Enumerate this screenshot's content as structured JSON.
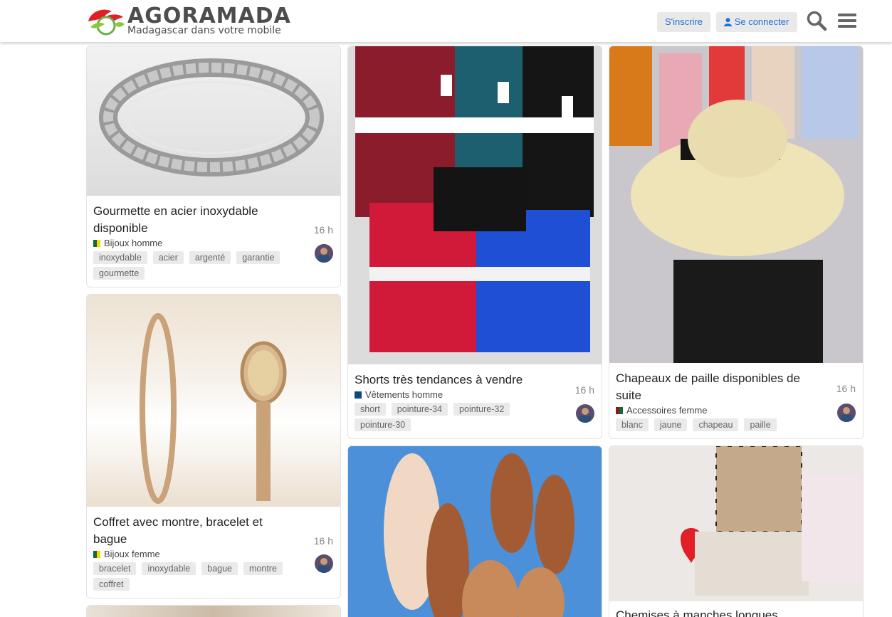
{
  "header": {
    "logo_title": "AGORAMADA",
    "logo_subtitle": "Madagascar dans votre mobile",
    "signup_label": "S'inscrire",
    "login_label": "Se connecter",
    "accent": "#1f6fd8"
  },
  "topics": [
    {
      "title": "Gourmette en acier inoxydable disponible",
      "category": "Bijoux homme",
      "category_colors": [
        "#0d6b3a",
        "#ffd400"
      ],
      "tags": [
        "inoxydable",
        "acier",
        "argenté",
        "garantie",
        "gourmette"
      ],
      "age": "16 h"
    },
    {
      "title": "Coffret avec montre, bracelet et bague",
      "category": "Bijoux femme",
      "category_colors": [
        "#0d6b3a",
        "#ffd400"
      ],
      "tags": [
        "bracelet",
        "inoxydable",
        "bague",
        "montre",
        "coffret"
      ],
      "age": "16 h"
    },
    {
      "title": "Shorts très tendances à vendre",
      "category": "Vêtements homme",
      "category_colors": [
        "#0d4a80",
        "#0d4a80"
      ],
      "tags": [
        "short",
        "pointure-34",
        "pointure-32",
        "pointure-30"
      ],
      "age": "16 h"
    },
    {
      "title": "Chapeaux de paille disponibles de suite",
      "category": "Accessoires femme",
      "category_colors": [
        "#8b1a1a",
        "#0d6b3a"
      ],
      "tags": [
        "blanc",
        "jaune",
        "chapeau",
        "paille"
      ],
      "age": "16 h"
    },
    {
      "title": "Chemises à manches longues",
      "category": "",
      "tags": [],
      "age": ""
    }
  ]
}
